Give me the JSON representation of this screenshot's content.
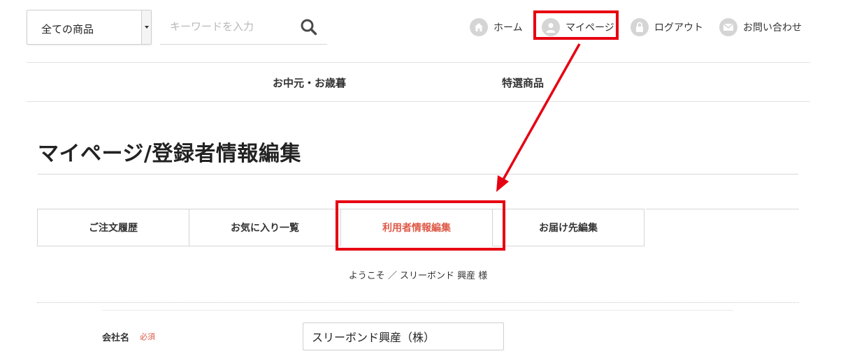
{
  "header": {
    "category_select": {
      "value": "全ての商品",
      "options": [
        "全ての商品"
      ]
    },
    "search": {
      "placeholder": "キーワードを入力",
      "icon": "search-icon"
    },
    "nav": [
      {
        "label": "ホーム",
        "icon": "home-icon"
      },
      {
        "label": "マイページ",
        "icon": "user-icon"
      },
      {
        "label": "ログアウト",
        "icon": "lock-icon"
      },
      {
        "label": "お問い合わせ",
        "icon": "mail-icon"
      }
    ]
  },
  "global_nav": [
    "お中元・お歳暮",
    "特選商品"
  ],
  "page_title": "マイページ/登録者情報編集",
  "tabs": [
    {
      "label": "ご注文履歴",
      "active": false
    },
    {
      "label": "お気に入り一覧",
      "active": false
    },
    {
      "label": "利用者情報編集",
      "active": true
    },
    {
      "label": "お届け先編集",
      "active": false
    }
  ],
  "welcome": "ようこそ ／ スリーボンド 興産 様",
  "form": {
    "company": {
      "label": "会社名",
      "required": "必須",
      "value": "スリーボンド興産（株）"
    }
  },
  "annotation": {
    "color": "#e60012"
  },
  "colors": {
    "active_tab": "#de5a48",
    "required": "#de5a48",
    "icon_bg": "#d5d5d5"
  }
}
